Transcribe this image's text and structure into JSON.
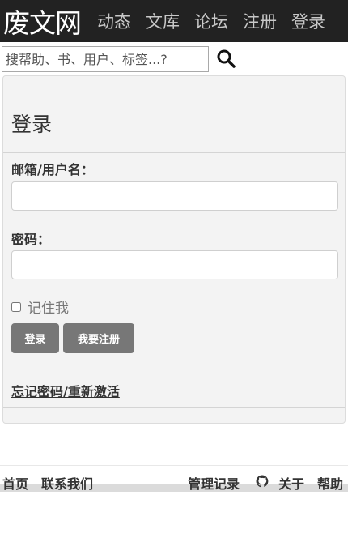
{
  "navbar": {
    "brand": "废文网",
    "items": [
      "动态",
      "文库",
      "论坛",
      "注册",
      "登录"
    ]
  },
  "search": {
    "placeholder": "搜帮助、书、用户、标签...?",
    "icon": "search-icon"
  },
  "login": {
    "title": "登录",
    "email_label": "邮箱/用户名：",
    "password_label": "密码：",
    "remember_label": "记住我",
    "login_button": "登录",
    "register_button": "我要注册",
    "forgot_link": "忘记密码/重新激活"
  },
  "footer": {
    "home": "首页",
    "contact": "联系我们",
    "admin_log": "管理记录",
    "github_icon": "github-icon",
    "about": "关于",
    "help": "帮助"
  }
}
